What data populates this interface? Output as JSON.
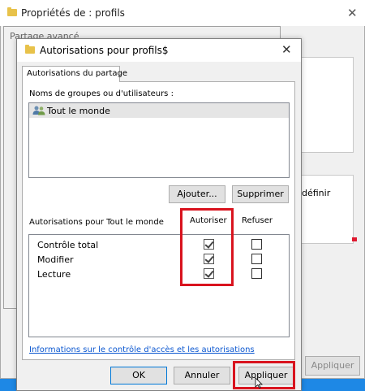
{
  "background_window": {
    "title": "Propriétés de : profils",
    "partial_text": "définir",
    "apply_button": "Appliquer"
  },
  "middle_window": {
    "title": "Partage avancé"
  },
  "dialog": {
    "title": "Autorisations pour profils$",
    "tab": "Autorisations du partage",
    "groups_label": "Noms de groupes ou d'utilisateurs :",
    "groups": [
      {
        "name": "Tout le monde",
        "selected": true
      }
    ],
    "add_button": "Ajouter...",
    "remove_button": "Supprimer",
    "permissions_label": "Autorisations pour Tout le monde",
    "columns": {
      "allow": "Autoriser",
      "deny": "Refuser"
    },
    "permissions": [
      {
        "name": "Contrôle total",
        "allow": true,
        "deny": false
      },
      {
        "name": "Modifier",
        "allow": true,
        "deny": false
      },
      {
        "name": "Lecture",
        "allow": true,
        "deny": false
      }
    ],
    "info_link": "Informations sur le contrôle d'accès et les autorisations",
    "ok_button": "OK",
    "cancel_button": "Annuler",
    "apply_button": "Appliquer"
  },
  "icons": {
    "folder": "folder-icon",
    "users": "users-icon",
    "close": "close-icon"
  },
  "colors": {
    "highlight": "#d9131e",
    "link": "#0b57d0",
    "taskbar": "#1e88e5",
    "folder": "#e8c24a"
  }
}
